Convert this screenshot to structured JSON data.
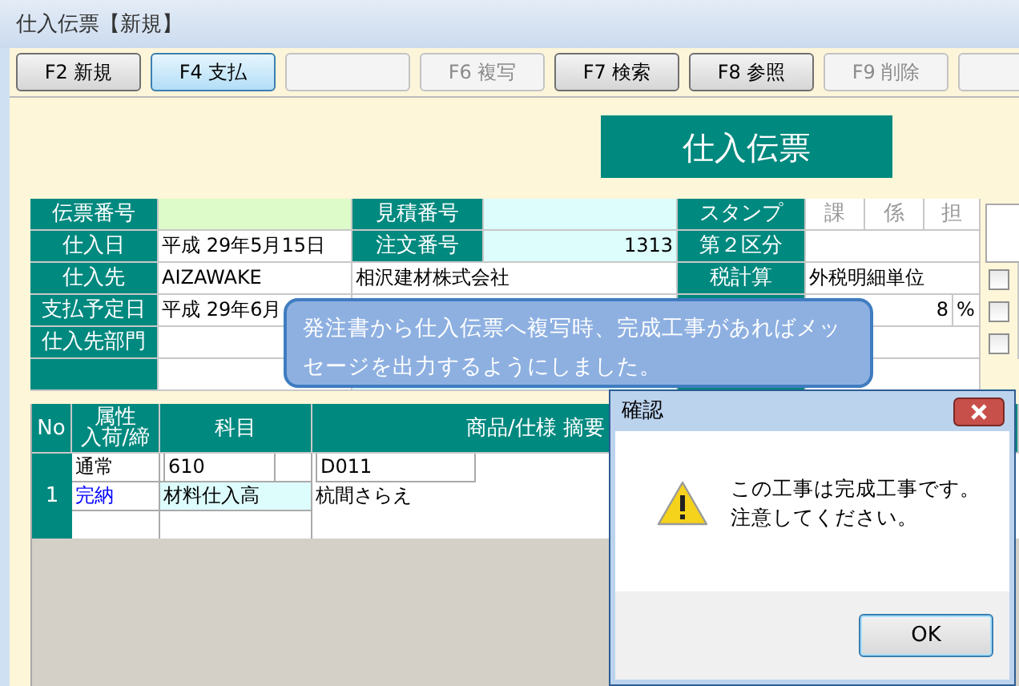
{
  "window": {
    "title": "仕入伝票【新規】"
  },
  "toolbar": [
    {
      "label": "F2 新規",
      "selected": false,
      "disabled": false
    },
    {
      "label": "F4 支払",
      "selected": true,
      "disabled": false
    },
    {
      "disabled": true
    },
    {
      "label": "F6 複写",
      "disabled": true
    },
    {
      "label": "F7 検索",
      "selected": false,
      "disabled": false
    },
    {
      "label": "F8 参照",
      "selected": false,
      "disabled": false
    },
    {
      "label": "F9 削除",
      "disabled": true
    },
    {
      "disabled": true
    }
  ],
  "form_title": "仕入伝票",
  "slip": {
    "left": [
      {
        "label": "伝票番号"
      },
      {
        "label": "仕入日",
        "value": "平成 29年5月15日"
      },
      {
        "label": "仕入先",
        "value": "AIZAWAKE"
      },
      {
        "label": "支払予定日",
        "value": "平成 29年6月"
      },
      {
        "label": "仕入先部門"
      }
    ],
    "middle": [
      {
        "label": "見積番号"
      },
      {
        "label": "注文番号",
        "value": "1313"
      }
    ],
    "supplier_name": "相沢建材株式会社",
    "right": [
      {
        "label": "スタンプ"
      },
      {
        "label": "第２区分"
      },
      {
        "label": "税計算",
        "value": "外税明細単位"
      },
      {
        "value": "8",
        "unit": "%"
      }
    ],
    "stamps": [
      "課",
      "係",
      "担"
    ],
    "checkboxes": [
      {
        "checked": false
      },
      {
        "checked": false
      },
      {
        "checked": false
      }
    ]
  },
  "details": {
    "columns": [
      {
        "label": "No"
      },
      {
        "label": "属性",
        "sublabel": "入荷/締"
      },
      {
        "label": "科目"
      },
      {
        "label": "商品/仕様 摘要"
      }
    ],
    "rows": [
      {
        "no": "1",
        "attributes": [
          {
            "text": "通常",
            "color": "#000000"
          },
          {
            "text": "完納",
            "color": "#0000ff"
          }
        ],
        "account_code": "610",
        "account_name": "材料仕入高",
        "item_code": "D011",
        "item_name": "杭間さらえ"
      }
    ]
  },
  "callout": {
    "text": "発注書から仕入伝票へ複写時、完成工事があればメッセージを出力するようにしました。"
  },
  "dialog": {
    "title": "確認",
    "message": [
      "この工事は完成工事です。",
      "注意してください。"
    ],
    "button": "OK"
  }
}
